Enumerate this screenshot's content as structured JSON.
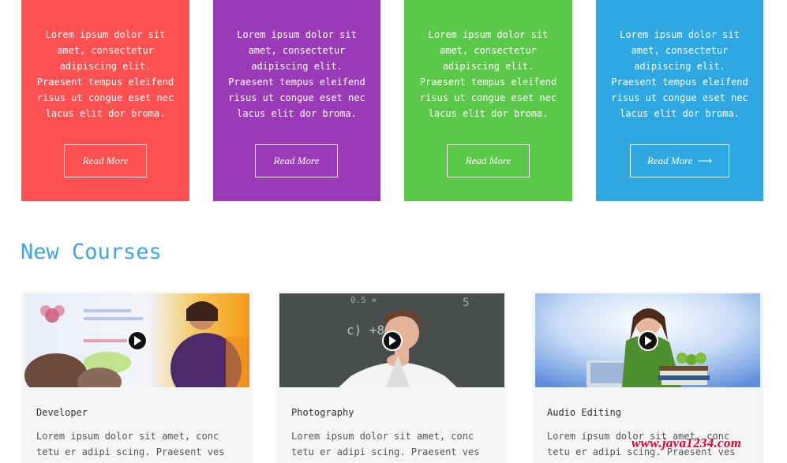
{
  "feature_cards": [
    {
      "text": "Lorem ipsum dolor sit\namet, consectetur\nadipiscing elit.\nPraesent tempus eleifend\nrisus ut congue eset nec\nlacus elit dor broma.",
      "button_label": "Read More",
      "button_arrow": "",
      "color": "#fc5150"
    },
    {
      "text": "Lorem ipsum dolor sit\namet, consectetur\nadipiscing elit.\nPraesent tempus eleifend\nrisus ut congue eset nec\nlacus elit dor broma.",
      "button_label": "Read More",
      "button_arrow": "",
      "color": "#9b3ab7"
    },
    {
      "text": "Lorem ipsum dolor sit\namet, consectetur\nadipiscing elit.\nPraesent tempus eleifend\nrisus ut congue eset nec\nlacus elit dor broma.",
      "button_label": "Read More",
      "button_arrow": "",
      "color": "#5cc84a"
    },
    {
      "text": "Lorem ipsum dolor sit\namet, consectetur\nadipiscing elit.\nPraesent tempus eleifend\nrisus ut congue eset nec\nlacus elit dor broma.",
      "button_label": "Read More",
      "button_arrow": "⟶",
      "color": "#2fa8e1"
    }
  ],
  "new_courses": {
    "title": "New Courses",
    "courses": [
      {
        "title": "Developer",
        "description": "Lorem ipsum dolor sit amet, conc tetu er adipi scing. Praesent ves",
        "thumbnail_icon": "play-icon"
      },
      {
        "title": "Photography",
        "description": "Lorem ipsum dolor sit amet, conc tetu er adipi scing. Praesent ves",
        "thumbnail_icon": "play-icon"
      },
      {
        "title": "Audio Editing",
        "description": "Lorem ipsum dolor sit amet, conc tetu er adipi scing. Praesent ves",
        "thumbnail_icon": "play-icon"
      }
    ]
  },
  "watermark": "www.java1234.com",
  "colors": {
    "section_title": "#3fa6dc",
    "course_card_bg": "#f4f5f7"
  }
}
